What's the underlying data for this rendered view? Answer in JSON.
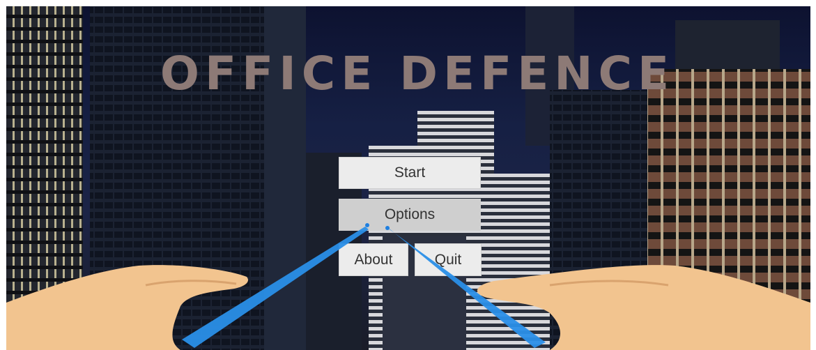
{
  "game": {
    "title": "OFFICE DEFENCE"
  },
  "menu": {
    "start_label": "Start",
    "options_label": "Options",
    "about_label": "About",
    "quit_label": "Quit",
    "hovered": "Options"
  },
  "colors": {
    "title": "#8d7a76",
    "button": "#ececec",
    "button_hover": "#cfcfcf",
    "pointer_ray": "#2a8fe8",
    "hand_skin": "#f2c48f"
  }
}
